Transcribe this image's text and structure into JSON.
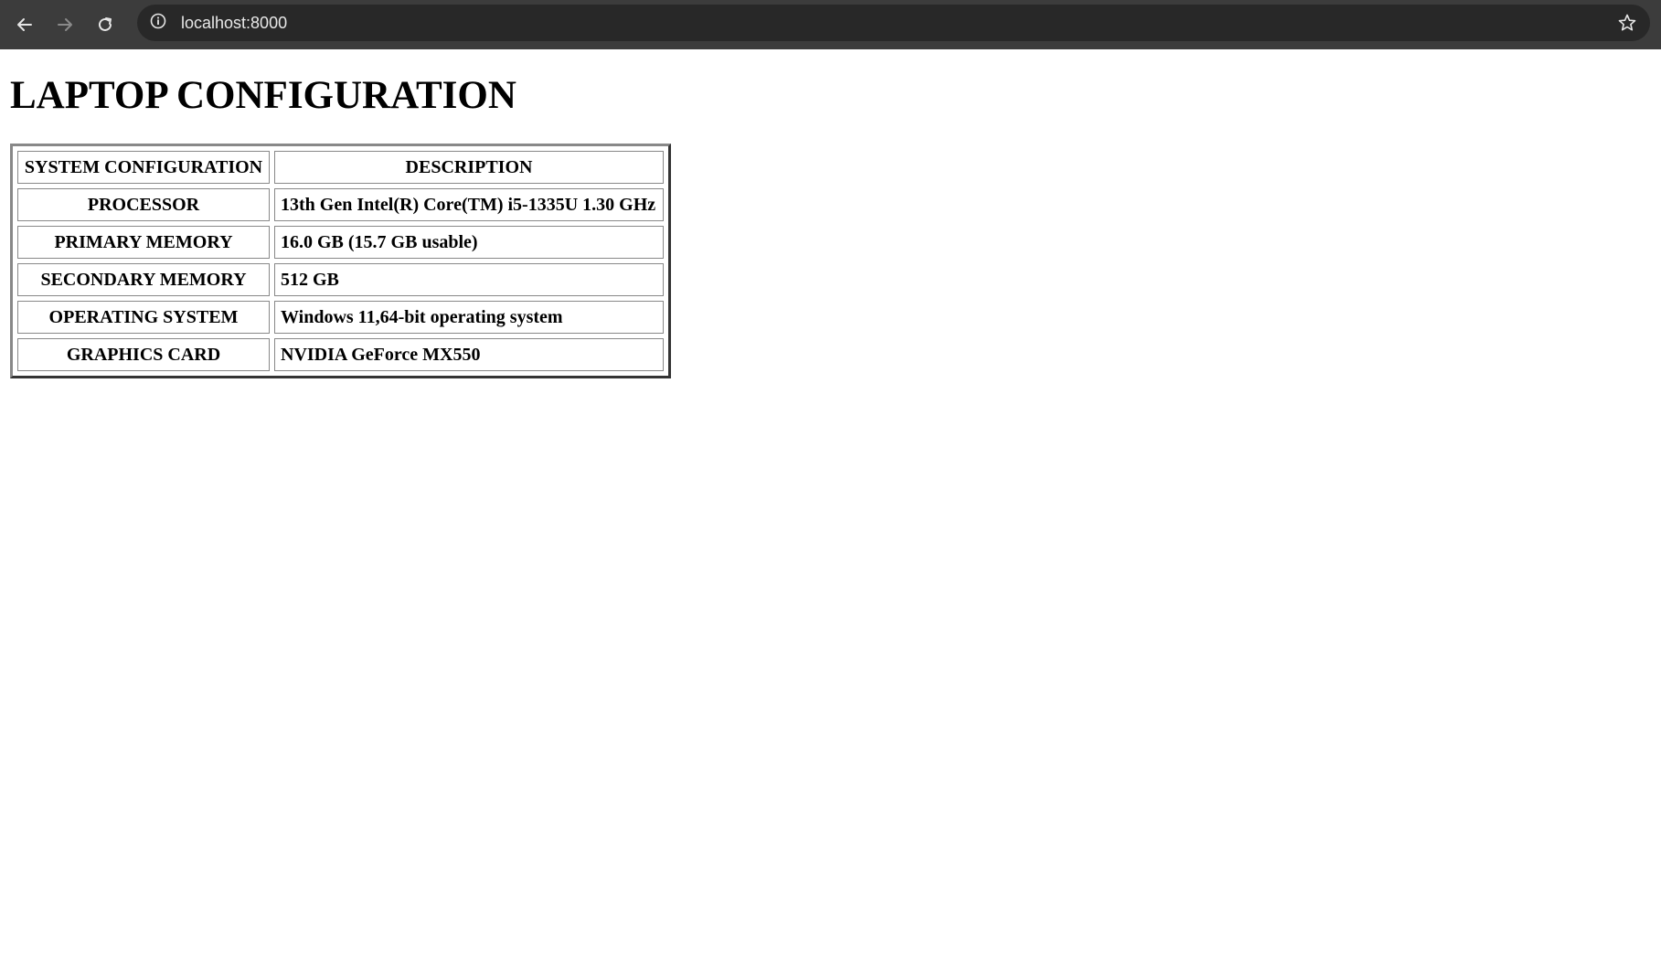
{
  "browser": {
    "url": "localhost:8000",
    "icons": {
      "back": "back-arrow-icon",
      "forward": "forward-arrow-icon",
      "reload": "reload-icon",
      "site_info": "info-icon",
      "bookmark": "star-icon"
    }
  },
  "page": {
    "title": "LAPTOP CONFIGURATION",
    "table": {
      "headers": [
        "SYSTEM CONFIGURATION",
        "DESCRIPTION"
      ],
      "rows": [
        {
          "key": "PROCESSOR",
          "value": "13th Gen Intel(R) Core(TM) i5-1335U 1.30 GHz"
        },
        {
          "key": "PRIMARY MEMORY",
          "value": "16.0 GB (15.7 GB usable)"
        },
        {
          "key": "SECONDARY MEMORY",
          "value": "512 GB"
        },
        {
          "key": "OPERATING SYSTEM",
          "value": "Windows 11,64-bit operating system"
        },
        {
          "key": "GRAPHICS CARD",
          "value": "NVIDIA GeForce MX550"
        }
      ]
    }
  }
}
